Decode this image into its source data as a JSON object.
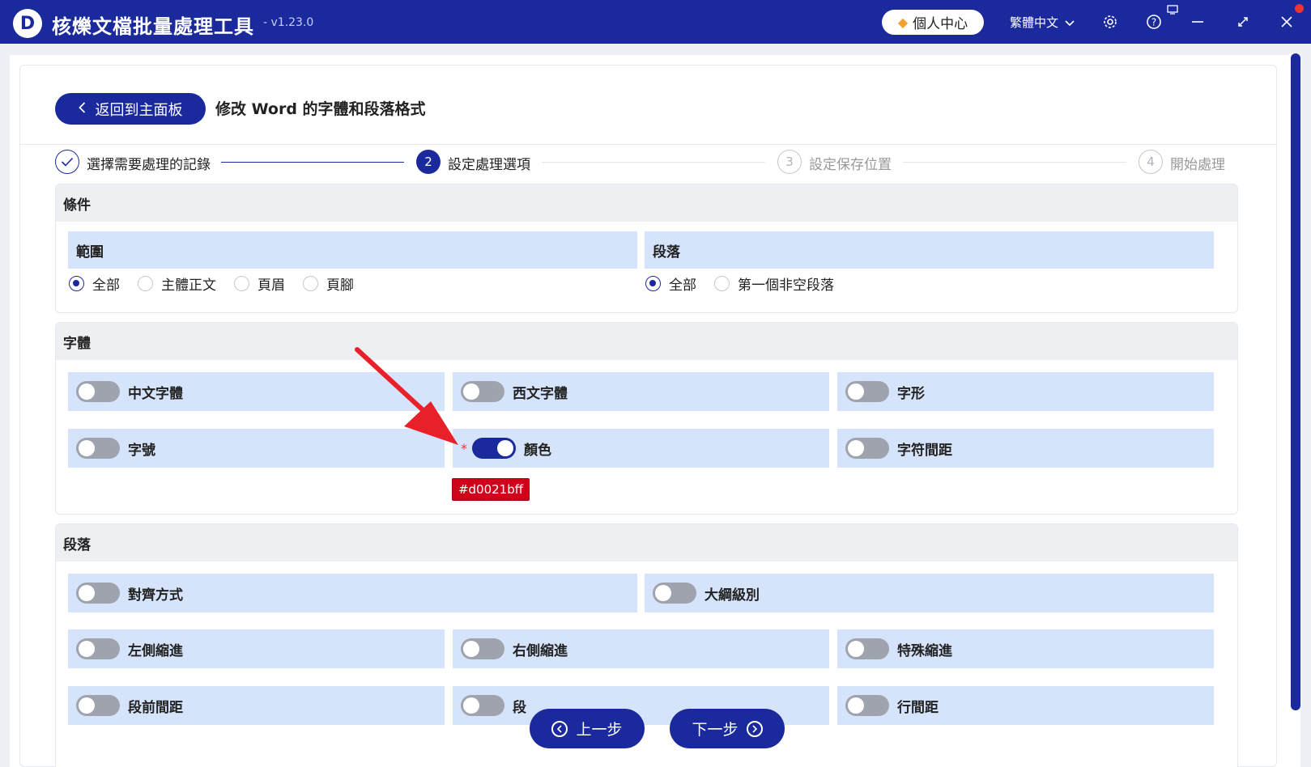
{
  "app": {
    "logo_letter": "D",
    "title": "核爍文檔批量處理工具",
    "version": "- v1.23.0",
    "user_center": "個人中心",
    "language": "繁體中文",
    "icons": [
      "settings-icon",
      "help-icon",
      "minimize-icon",
      "maximize-icon",
      "close-icon"
    ]
  },
  "header": {
    "back_label": "返回到主面板",
    "page_title": "修改 Word 的字體和段落格式"
  },
  "steps": [
    {
      "num": "✓",
      "label": "選擇需要處理的記錄",
      "state": "done"
    },
    {
      "num": "2",
      "label": "設定處理選項",
      "state": "active"
    },
    {
      "num": "3",
      "label": "設定保存位置",
      "state": "pending"
    },
    {
      "num": "4",
      "label": "開始處理",
      "state": "pending"
    }
  ],
  "conditions": {
    "title": "條件",
    "scope": {
      "title": "範圍",
      "options": [
        "全部",
        "主體正文",
        "頁眉",
        "頁腳"
      ],
      "selected": "全部"
    },
    "paragraph": {
      "title": "段落",
      "options": [
        "全部",
        "第一個非空段落"
      ],
      "selected": "全部"
    }
  },
  "font": {
    "title": "字體",
    "items": [
      {
        "label": "中文字體",
        "on": false
      },
      {
        "label": "西文字體",
        "on": false
      },
      {
        "label": "字形",
        "on": false
      },
      {
        "label": "字號",
        "on": false
      },
      {
        "label": "顏色",
        "on": true,
        "required": "*"
      },
      {
        "label": "字符間距",
        "on": false
      }
    ],
    "color_value": "#d0021bff",
    "color_hex": "#d0021b"
  },
  "paragraph_section": {
    "title": "段落",
    "items": [
      {
        "label": "對齊方式",
        "on": false
      },
      {
        "label": "大綱級別",
        "on": false
      },
      {
        "label": "左側縮進",
        "on": false
      },
      {
        "label": "右側縮進",
        "on": false
      },
      {
        "label": "特殊縮進",
        "on": false
      },
      {
        "label": "段前間距",
        "on": false
      },
      {
        "label": "段",
        "on": false
      },
      {
        "label": "行間距",
        "on": false
      }
    ]
  },
  "nav": {
    "prev_label": "上一步",
    "next_label": "下一步"
  },
  "colors": {
    "primary": "#1a2a9c",
    "card_blue": "#d6e4fb",
    "annotation_arrow": "#e8202a"
  }
}
